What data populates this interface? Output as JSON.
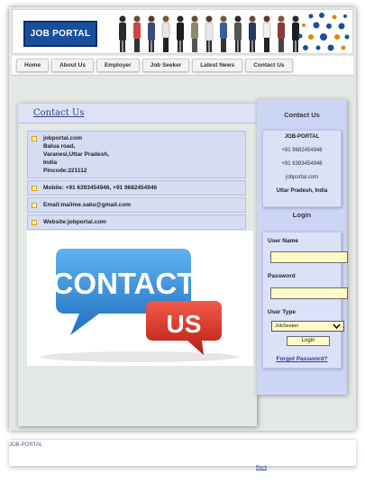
{
  "header": {
    "logo_text": "JOB PORTAL"
  },
  "nav": {
    "items": [
      "Home",
      "About Us",
      "Employer",
      "Job Seeker",
      "Latest News",
      "Contact Us"
    ]
  },
  "main": {
    "title": "Contact Us",
    "address_lines": [
      "jobportal.com",
      "Balua road,",
      "Varanesi,Uttar Pradesh,",
      "India",
      "Pincode:221112"
    ],
    "mobile": "Mobile: +91 6393454946, +91 9682454946",
    "email": "Email:mailme.saku@gmail.com",
    "website": "Website:jobportal.com",
    "image_text_top": "CONTACT",
    "image_text_bottom": "US"
  },
  "sidebar": {
    "contact_heading": "Contact Us",
    "contact_card": {
      "name": "JOB-PORTAL",
      "phone1": "+91 9682454946",
      "phone2": "+91 6393454946",
      "site": "jobportal.com",
      "state": "Uttar Pradesh, India"
    },
    "login_heading": "Login",
    "login": {
      "username_label": "User Name",
      "password_label": "Password",
      "usertype_label": "User Type",
      "usertype_value": "JobSeeker",
      "login_button": "Login",
      "forgot_link": "Forgot Password?"
    }
  },
  "footer": {
    "text": "JOB-PORTAL",
    "back_link": "Back"
  },
  "colors": {
    "brand_blue": "#1a4f9e",
    "panel_blue": "#cdd5f4",
    "input_yellow": "#fffbc8",
    "link_blue": "#2e3f8f"
  }
}
